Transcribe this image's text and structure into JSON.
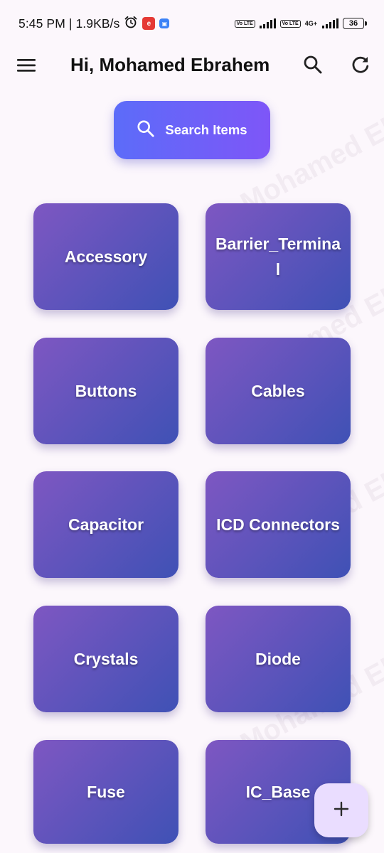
{
  "status_bar": {
    "time_speed": "5:45 PM | 1.9KB/s",
    "alarm_icon": "alarm-icon",
    "app_badge_1": "e",
    "app_badge_2": "▣",
    "volte": "Vo LTE",
    "network": "4G+",
    "battery": "36"
  },
  "app_bar": {
    "title": "Hi, Mohamed Ebrahem",
    "menu_icon": "menu-icon",
    "search_icon": "search-icon",
    "refresh_icon": "refresh-icon"
  },
  "search": {
    "label": "Search Items"
  },
  "watermark": {
    "text": "Mohamed Ebrahem"
  },
  "categories": [
    "Accessory",
    "Barrier_Terminal",
    "Buttons",
    "Cables",
    "Capacitor",
    "ICD Connectors",
    "Crystals",
    "Diode",
    "Fuse",
    "IC_Base"
  ],
  "fab": {
    "icon": "plus-icon"
  },
  "colors": {
    "background": "#FCF7FC",
    "card_gradient_start": "#7E57C2",
    "card_gradient_end": "#3F51B5",
    "search_gradient_start": "#5C6CF9",
    "search_gradient_end": "#7E56F8",
    "fab_background": "#EADDFF"
  }
}
